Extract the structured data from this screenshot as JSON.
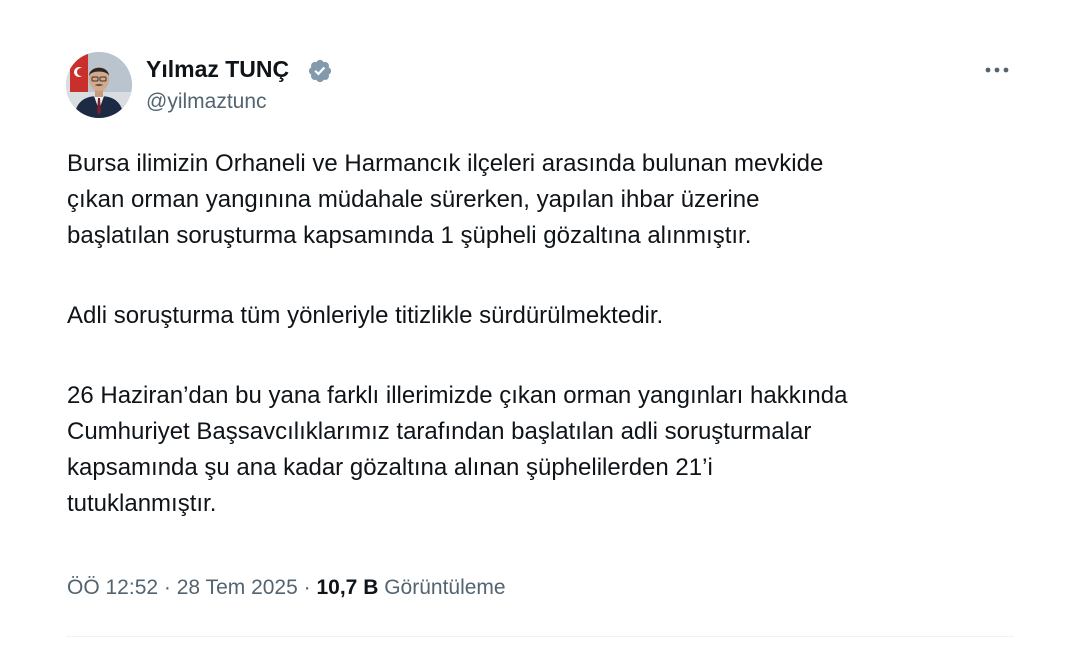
{
  "author": {
    "name": "Yılmaz TUNÇ",
    "handle": "@yilmaztunc",
    "verified": true,
    "verified_color": "#829aab"
  },
  "tweet": {
    "paragraphs": [
      "Bursa ilimizin Orhaneli ve Harmancık ilçeleri arasında bulunan mevkide\nçıkan orman yangınına müdahale sürerken, yapılan ihbar üzerine\nbaşlatılan soruşturma kapsamında 1 şüpheli gözaltına alınmıştır.",
      "Adli soruşturma tüm yönleriyle titizlikle sürdürülmektedir.",
      "26 Haziran’dan bu yana farklı illerimizde çıkan orman yangınları hakkında\nCumhuriyet Başsavcılıklarımız tarafından başlatılan adli soruşturmalar\nkapsamında şu ana kadar gözaltına alınan şüphelilerden 21’i\ntutuklanmıştır."
    ]
  },
  "meta": {
    "time": "ÖÖ 12:52",
    "separator": "·",
    "date": "28 Tem 2025",
    "views_count": "10,7 B",
    "views_label": "Görüntüleme"
  },
  "icons": {
    "verified": "verified-badge-icon",
    "more": "more-dots-icon"
  },
  "colors": {
    "text": "#0f1419",
    "secondary": "#536471",
    "divider": "#eff3f4"
  }
}
